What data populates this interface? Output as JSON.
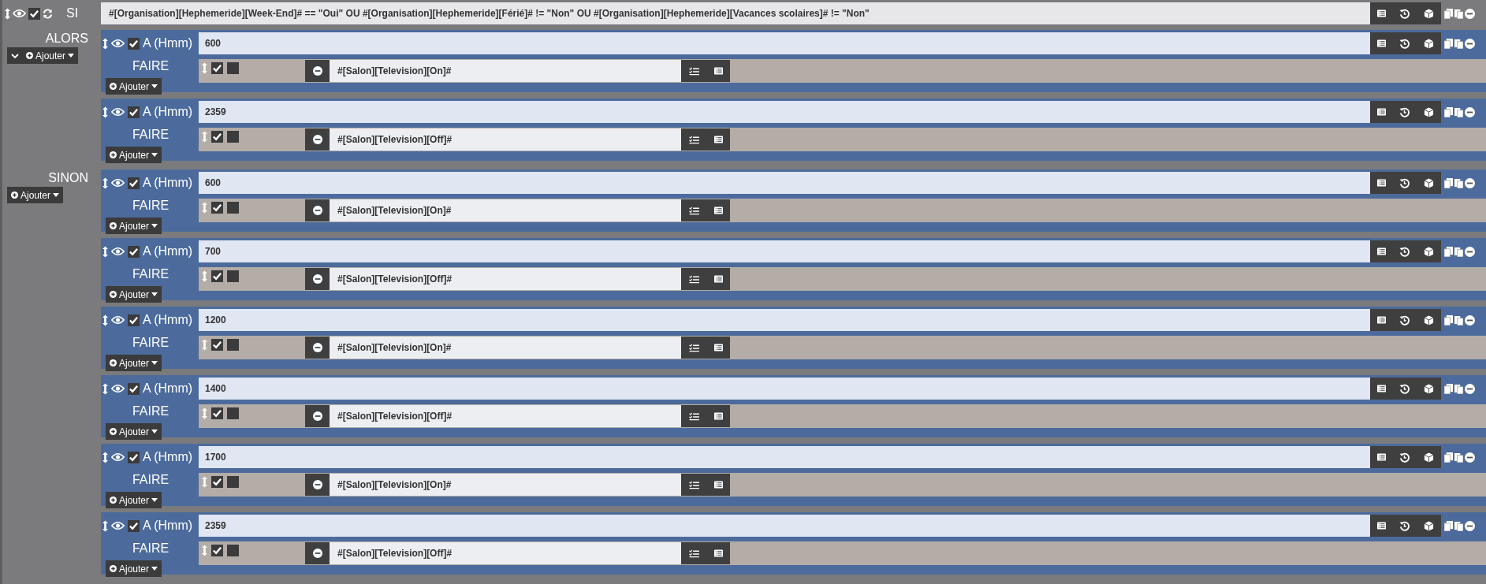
{
  "si": {
    "label": "SI",
    "checked": true,
    "condition": "#[Organisation][Hephemeride][Week-End]# == \"Oui\" OU #[Organisation][Hephemeride][Férié]# != \"Non\" OU #[Organisation][Hephemeride][Vacances scolaires]# != \"Non\""
  },
  "sections": [
    {
      "label": "ALORS",
      "collapse": true,
      "add": "Ajouter",
      "blocks": [
        {
          "label": "A (Hmm)",
          "checked": true,
          "value": "600",
          "faire": "FAIRE",
          "add": "Ajouter",
          "actions": [
            {
              "checked": true,
              "parallel": false,
              "command": "#[Salon][Television][On]#"
            }
          ]
        },
        {
          "label": "A (Hmm)",
          "checked": true,
          "value": "2359",
          "faire": "FAIRE",
          "add": "Ajouter",
          "actions": [
            {
              "checked": true,
              "parallel": false,
              "command": "#[Salon][Television][Off]#"
            }
          ]
        }
      ]
    },
    {
      "label": "SINON",
      "collapse": false,
      "add": "Ajouter",
      "blocks": [
        {
          "label": "A (Hmm)",
          "checked": true,
          "value": "600",
          "faire": "FAIRE",
          "add": "Ajouter",
          "actions": [
            {
              "checked": true,
              "parallel": false,
              "command": "#[Salon][Television][On]#"
            }
          ]
        },
        {
          "label": "A (Hmm)",
          "checked": true,
          "value": "700",
          "faire": "FAIRE",
          "add": "Ajouter",
          "actions": [
            {
              "checked": true,
              "parallel": false,
              "command": "#[Salon][Television][Off]#"
            }
          ]
        },
        {
          "label": "A (Hmm)",
          "checked": true,
          "value": "1200",
          "faire": "FAIRE",
          "add": "Ajouter",
          "actions": [
            {
              "checked": true,
              "parallel": false,
              "command": "#[Salon][Television][On]#"
            }
          ]
        },
        {
          "label": "A (Hmm)",
          "checked": true,
          "value": "1400",
          "faire": "FAIRE",
          "add": "Ajouter",
          "actions": [
            {
              "checked": true,
              "parallel": false,
              "command": "#[Salon][Television][Off]#"
            }
          ]
        },
        {
          "label": "A (Hmm)",
          "checked": true,
          "value": "1700",
          "faire": "FAIRE",
          "add": "Ajouter",
          "actions": [
            {
              "checked": true,
              "parallel": false,
              "command": "#[Salon][Television][On]#"
            }
          ]
        },
        {
          "label": "A (Hmm)",
          "checked": true,
          "value": "2359",
          "faire": "FAIRE",
          "add": "Ajouter",
          "actions": [
            {
              "checked": true,
              "parallel": false,
              "command": "#[Salon][Television][Off]#"
            }
          ]
        }
      ]
    }
  ]
}
